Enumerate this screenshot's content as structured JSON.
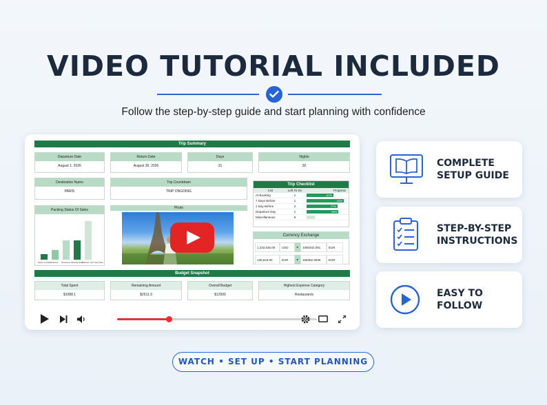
{
  "headline": "VIDEO TUTORIAL INCLUDED",
  "subtitle": "Follow the step-by-step guide and start planning with confidence",
  "tagline": "WATCH • SET UP • START PLANNING",
  "colors": {
    "accent": "#2563d6",
    "sheet_green": "#1f7a47",
    "play_red": "#e32424"
  },
  "features": [
    {
      "icon": "open-book-monitor-icon",
      "text": "COMPLETE\nSETUP GUIDE"
    },
    {
      "icon": "clipboard-checklist-icon",
      "text": "STEP-BY-STEP\nINSTRUCTIONS"
    },
    {
      "icon": "play-circle-icon",
      "text": "EASY TO\nFOLLOW"
    }
  ],
  "sheet": {
    "title": "Trip Summary",
    "departure": {
      "label": "Departure Date",
      "value": "August 1, 2026"
    },
    "return": {
      "label": "Return Date",
      "value": "August 30, 2026"
    },
    "days": {
      "label": "Days",
      "value": "31"
    },
    "nights": {
      "label": "Nights",
      "value": "30"
    },
    "destination": {
      "label": "Destination Name",
      "value": "PARIS"
    },
    "countdown": {
      "label": "Trip Countdown",
      "value": "TRIP ONGOING"
    },
    "checklist": {
      "title": "Trip Checklist",
      "headers": [
        "List",
        "Left To Do",
        "Progress"
      ],
      "rows": [
        {
          "name": "At Booking",
          "left": "1",
          "progress": 67,
          "progress_label": "67%"
        },
        {
          "name": "7 Days Before",
          "left": "1",
          "progress": 93,
          "progress_label": "93%"
        },
        {
          "name": "1 Day Before",
          "left": "2",
          "progress": 77,
          "progress_label": "77%"
        },
        {
          "name": "Departure Day",
          "left": "1",
          "progress": 80,
          "progress_label": "80%"
        },
        {
          "name": "Miscellaneous",
          "left": "6",
          "progress": 20,
          "progress_label": ""
        }
      ]
    },
    "currency": {
      "title": "Currency Exchange",
      "rows": [
        {
          "amount": "1,233,635.00",
          "from": "USD",
          "result": "1050342.091",
          "to": "EUR"
        },
        {
          "amount": "135,643.00",
          "from": "EUR",
          "result": "158352.3036",
          "to": "EUR"
        }
      ]
    },
    "packing_chart": {
      "title": "Packing Status Of Sales",
      "labels": [
        "Need to Order",
        "Ordered",
        "Received",
        "Already Have",
        "Packed",
        "Get Next Sets"
      ]
    },
    "photo_label": "Photo",
    "budget": {
      "title": "Budget Snapshot",
      "spent": {
        "label": "Total Spent",
        "value": "$1088.1"
      },
      "remaining": {
        "label": "Remaining Amount",
        "value": "$2511.9"
      },
      "overall": {
        "label": "Overall Budget",
        "value": "$12500"
      },
      "category": {
        "label": "Highest Expense Category",
        "value": "Restaurants"
      }
    }
  },
  "player": {
    "progress": 0.26
  }
}
